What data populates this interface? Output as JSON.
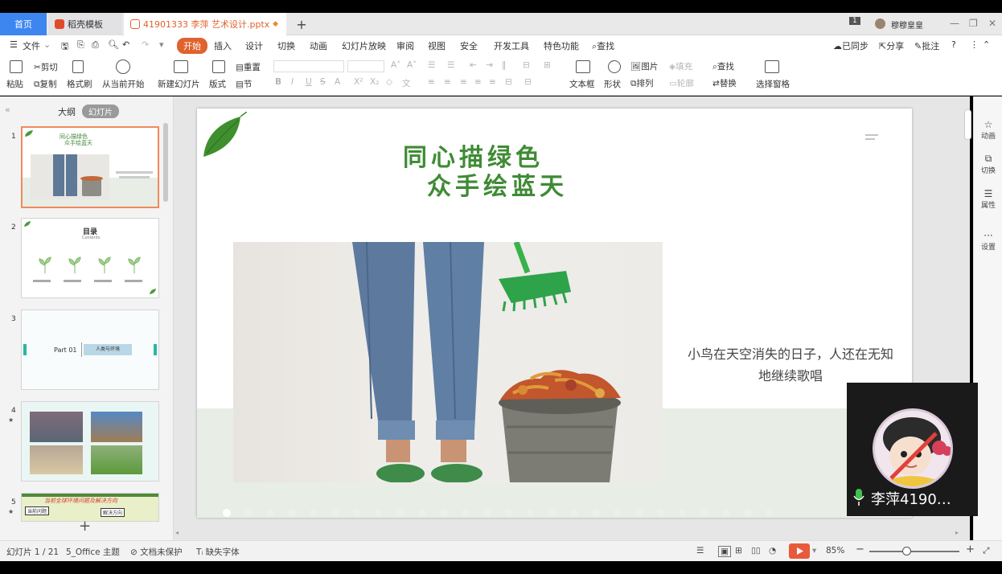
{
  "tabs": {
    "home": "首页",
    "templates": "稻壳模板",
    "document": "41901333 李萍 艺术设计.pptx",
    "add": "+"
  },
  "window": {
    "page_badge": "1",
    "user_name": "穆穆皇皇"
  },
  "menu": {
    "file": "文件",
    "items": [
      "开始",
      "插入",
      "设计",
      "切换",
      "动画",
      "幻灯片放映",
      "审阅",
      "视图",
      "安全",
      "开发工具",
      "特色功能"
    ],
    "search": "查找",
    "synced": "已同步",
    "share": "分享",
    "annotate": "批注"
  },
  "ribbon": {
    "paste": "粘贴",
    "cut": "剪切",
    "copy": "复制",
    "format_painter": "格式刷",
    "from_current": "从当前开始",
    "new_slide": "新建幻灯片",
    "layout": "版式",
    "reset": "重置",
    "section": "节",
    "text_box": "文本框",
    "shape": "形状",
    "picture": "图片",
    "fill": "填充",
    "arrange": "排列",
    "outline": "轮廓",
    "find": "查找",
    "replace": "替换",
    "select_pane": "选择窗格"
  },
  "left_panel": {
    "outline_tab": "大纲",
    "slides_tab": "幻灯片",
    "thumbnails": [
      {
        "num": "1",
        "title": "同心描绿色",
        "subtitle": "众手绘蓝天"
      },
      {
        "num": "2",
        "title": "目录",
        "subtitle": "Contents"
      },
      {
        "num": "3",
        "part": "Part 01",
        "label": "人类与环境"
      },
      {
        "num": "4"
      },
      {
        "num": "5",
        "title": "当前全球环境问题及解决方向",
        "tag1": "当前问题",
        "tag2": "解决方向"
      }
    ]
  },
  "slide": {
    "title_line1": "同心描绿色",
    "title_line2": "众手绘蓝天",
    "caption": "小鸟在天空消失的日子，人还在无知地继续歌唱"
  },
  "right_panel": {
    "animation": "动画",
    "transition": "切换",
    "properties": "属性",
    "settings": "设置"
  },
  "webcam": {
    "name": "李萍4190…"
  },
  "status": {
    "slide_info": "幻灯片 1 / 21",
    "theme": "5_Office 主题",
    "protection": "文档未保护",
    "missing_font": "缺失字体",
    "zoom": "85%"
  },
  "colors": {
    "accent": "#e0622e",
    "title_green": "#3f8b35",
    "tab_blue": "#3d86f0"
  }
}
